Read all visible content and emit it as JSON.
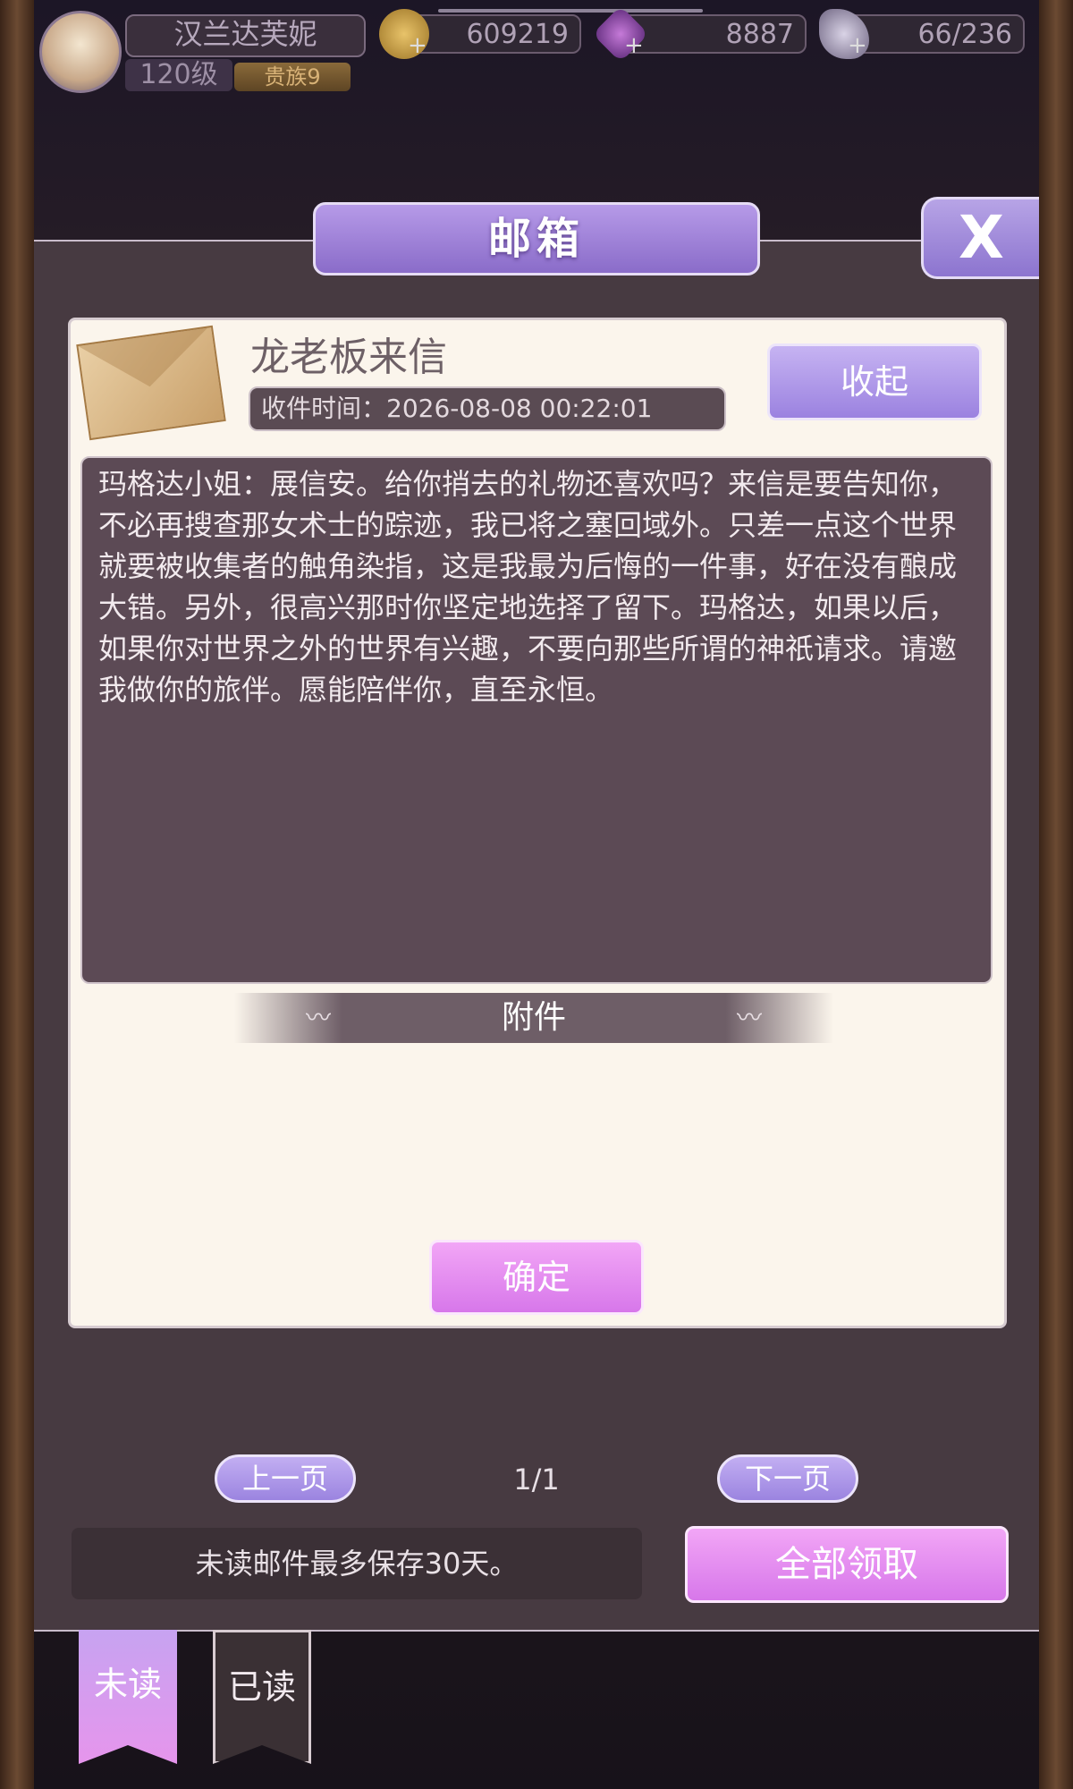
{
  "player": {
    "name": "汉兰达芙妮",
    "level": "120级",
    "rank": "贵族9"
  },
  "resources": {
    "gold": "609219",
    "diamonds": "8887",
    "stamina": "66/236"
  },
  "mailbox": {
    "title": "邮箱",
    "close_label": "X",
    "mail": {
      "title": "龙老板来信",
      "received_time": "收件时间：2026-08-08 00:22:01",
      "collapse_label": "收起",
      "body": "玛格达小姐：展信安。给你捎去的礼物还喜欢吗？来信是要告知你，不必再搜查那女术士的踪迹，我已将之塞回域外。只差一点这个世界就要被收集者的触角染指，这是我最为后悔的一件事，好在没有酿成大错。另外，很高兴那时你坚定地选择了留下。玛格达，如果以后，如果你对世界之外的世界有兴趣，不要向那些所谓的神祇请求。请邀我做你的旅伴。愿能陪伴你，直至永恒。",
      "attachments_label": "附件",
      "confirm_label": "确定"
    },
    "pager": {
      "prev_label": "上一页",
      "next_label": "下一页",
      "page": "1/1"
    },
    "notice": "未读邮件最多保存30天。",
    "claim_all_label": "全部领取"
  },
  "tabs": {
    "unread": "未读",
    "read": "已读"
  },
  "colors": {
    "accent_purple": "#9b82e0",
    "accent_pink": "#d777ea",
    "panel": "#473a41",
    "card": "#fbf5ec"
  }
}
